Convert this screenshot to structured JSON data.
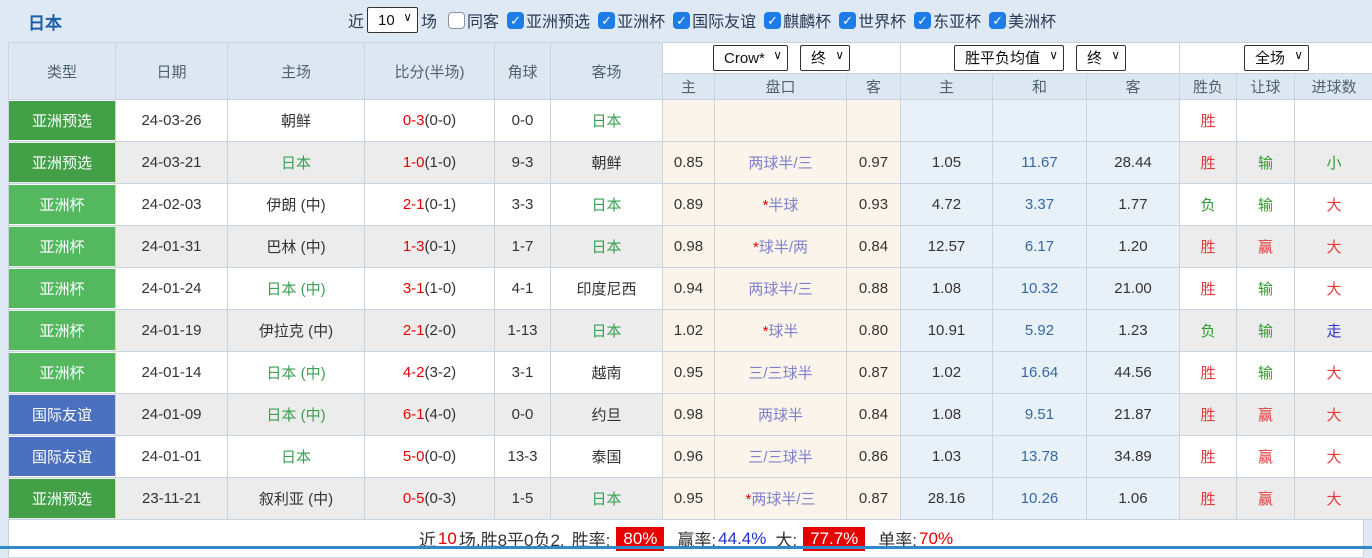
{
  "header": {
    "title": "日本"
  },
  "filters": {
    "recent_label": "近",
    "recent_value": "10",
    "matches_label": "场",
    "same_venue": {
      "label": "同客",
      "checked": false
    },
    "competitions": [
      {
        "label": "亚洲预选",
        "checked": true
      },
      {
        "label": "亚洲杯",
        "checked": true
      },
      {
        "label": "国际友谊",
        "checked": true
      },
      {
        "label": "麒麟杯",
        "checked": true
      },
      {
        "label": "世界杯",
        "checked": true
      },
      {
        "label": "东亚杯",
        "checked": true
      },
      {
        "label": "美洲杯",
        "checked": true
      }
    ]
  },
  "colors": {
    "badge_green_dark": "#43a047",
    "badge_green_light": "#54b85f",
    "badge_blue": "#4b70c0",
    "win_red": "#e23b3b",
    "loss_green": "#319a31",
    "push_blue": "#3333cc",
    "team_green": "#3aa053",
    "score_red": "#e60000",
    "handicap_text": "#8080cf",
    "avg_draw_text": "#3567a6",
    "title_blue": "#1b5fa8",
    "checkbox_blue": "#1e7ce8",
    "rate_badge_bg": "#e60000",
    "bottom_line": "#3089cc"
  },
  "table": {
    "columns": {
      "type": "类型",
      "date": "日期",
      "home": "主场",
      "score": "比分(半场)",
      "corner": "角球",
      "away": "客场",
      "sub_home": "主",
      "sub_handicap": "盘口",
      "sub_away": "客",
      "sub_avg_home": "主",
      "sub_avg_draw": "和",
      "sub_avg_away": "客",
      "result": "胜负",
      "handicap_result": "让球",
      "goals": "进球数"
    },
    "dropdowns": {
      "odds_source": "Crow*",
      "odds_time": "终",
      "avg_source": "胜平负均值",
      "avg_time": "终",
      "scope": "全场"
    },
    "rows": [
      {
        "type": {
          "label": "亚洲预选",
          "style": "green-dark"
        },
        "date": "24-03-26",
        "home": {
          "name": "朝鲜",
          "jp": false
        },
        "score": {
          "main": "0-3",
          "half": "(0-0)"
        },
        "corner": "0-0",
        "away": {
          "name": "日本",
          "jp": true
        },
        "crow": {
          "home": "",
          "star": false,
          "handicap": "",
          "away": ""
        },
        "avg": {
          "home": "",
          "draw": "",
          "away": ""
        },
        "result": {
          "text": "胜",
          "style": "red"
        },
        "let": {
          "text": "",
          "style": ""
        },
        "goals": {
          "text": "",
          "style": ""
        }
      },
      {
        "type": {
          "label": "亚洲预选",
          "style": "green-dark"
        },
        "date": "24-03-21",
        "home": {
          "name": "日本",
          "jp": true
        },
        "score": {
          "main": "1-0",
          "half": "(1-0)"
        },
        "corner": "9-3",
        "away": {
          "name": "朝鲜",
          "jp": false
        },
        "crow": {
          "home": "0.85",
          "star": false,
          "handicap": "两球半/三",
          "away": "0.97"
        },
        "avg": {
          "home": "1.05",
          "draw": "11.67",
          "away": "28.44"
        },
        "result": {
          "text": "胜",
          "style": "red"
        },
        "let": {
          "text": "输",
          "style": "green"
        },
        "goals": {
          "text": "小",
          "style": "green"
        }
      },
      {
        "type": {
          "label": "亚洲杯",
          "style": "green-light"
        },
        "date": "24-02-03",
        "home": {
          "name": "伊朗 (中)",
          "jp": false
        },
        "score": {
          "main": "2-1",
          "half": "(0-1)"
        },
        "corner": "3-3",
        "away": {
          "name": "日本",
          "jp": true
        },
        "crow": {
          "home": "0.89",
          "star": true,
          "handicap": "半球",
          "away": "0.93"
        },
        "avg": {
          "home": "4.72",
          "draw": "3.37",
          "away": "1.77"
        },
        "result": {
          "text": "负",
          "style": "green"
        },
        "let": {
          "text": "输",
          "style": "green"
        },
        "goals": {
          "text": "大",
          "style": "red"
        }
      },
      {
        "type": {
          "label": "亚洲杯",
          "style": "green-light"
        },
        "date": "24-01-31",
        "home": {
          "name": "巴林 (中)",
          "jp": false
        },
        "score": {
          "main": "1-3",
          "half": "(0-1)"
        },
        "corner": "1-7",
        "away": {
          "name": "日本",
          "jp": true
        },
        "crow": {
          "home": "0.98",
          "star": true,
          "handicap": "球半/两",
          "away": "0.84"
        },
        "avg": {
          "home": "12.57",
          "draw": "6.17",
          "away": "1.20"
        },
        "result": {
          "text": "胜",
          "style": "red"
        },
        "let": {
          "text": "赢",
          "style": "red"
        },
        "goals": {
          "text": "大",
          "style": "red"
        }
      },
      {
        "type": {
          "label": "亚洲杯",
          "style": "green-light"
        },
        "date": "24-01-24",
        "home": {
          "name": "日本 (中)",
          "jp": true
        },
        "score": {
          "main": "3-1",
          "half": "(1-0)"
        },
        "corner": "4-1",
        "away": {
          "name": "印度尼西",
          "jp": false
        },
        "crow": {
          "home": "0.94",
          "star": false,
          "handicap": "两球半/三",
          "away": "0.88"
        },
        "avg": {
          "home": "1.08",
          "draw": "10.32",
          "away": "21.00"
        },
        "result": {
          "text": "胜",
          "style": "red"
        },
        "let": {
          "text": "输",
          "style": "green"
        },
        "goals": {
          "text": "大",
          "style": "red"
        }
      },
      {
        "type": {
          "label": "亚洲杯",
          "style": "green-light"
        },
        "date": "24-01-19",
        "home": {
          "name": "伊拉克 (中)",
          "jp": false
        },
        "score": {
          "main": "2-1",
          "half": "(2-0)"
        },
        "corner": "1-13",
        "away": {
          "name": "日本",
          "jp": true
        },
        "crow": {
          "home": "1.02",
          "star": true,
          "handicap": "球半",
          "away": "0.80"
        },
        "avg": {
          "home": "10.91",
          "draw": "5.92",
          "away": "1.23"
        },
        "result": {
          "text": "负",
          "style": "green"
        },
        "let": {
          "text": "输",
          "style": "green"
        },
        "goals": {
          "text": "走",
          "style": "blue"
        }
      },
      {
        "type": {
          "label": "亚洲杯",
          "style": "green-light"
        },
        "date": "24-01-14",
        "home": {
          "name": "日本 (中)",
          "jp": true
        },
        "score": {
          "main": "4-2",
          "half": "(3-2)"
        },
        "corner": "3-1",
        "away": {
          "name": "越南",
          "jp": false
        },
        "crow": {
          "home": "0.95",
          "star": false,
          "handicap": "三/三球半",
          "away": "0.87"
        },
        "avg": {
          "home": "1.02",
          "draw": "16.64",
          "away": "44.56"
        },
        "result": {
          "text": "胜",
          "style": "red"
        },
        "let": {
          "text": "输",
          "style": "green"
        },
        "goals": {
          "text": "大",
          "style": "red"
        }
      },
      {
        "type": {
          "label": "国际友谊",
          "style": "blue"
        },
        "date": "24-01-09",
        "home": {
          "name": "日本 (中)",
          "jp": true
        },
        "score": {
          "main": "6-1",
          "half": "(4-0)"
        },
        "corner": "0-0",
        "away": {
          "name": "约旦",
          "jp": false
        },
        "crow": {
          "home": "0.98",
          "star": false,
          "handicap": "两球半",
          "away": "0.84"
        },
        "avg": {
          "home": "1.08",
          "draw": "9.51",
          "away": "21.87"
        },
        "result": {
          "text": "胜",
          "style": "red"
        },
        "let": {
          "text": "赢",
          "style": "red"
        },
        "goals": {
          "text": "大",
          "style": "red"
        }
      },
      {
        "type": {
          "label": "国际友谊",
          "style": "blue"
        },
        "date": "24-01-01",
        "home": {
          "name": "日本",
          "jp": true
        },
        "score": {
          "main": "5-0",
          "half": "(0-0)"
        },
        "corner": "13-3",
        "away": {
          "name": "泰国",
          "jp": false
        },
        "crow": {
          "home": "0.96",
          "star": false,
          "handicap": "三/三球半",
          "away": "0.86"
        },
        "avg": {
          "home": "1.03",
          "draw": "13.78",
          "away": "34.89"
        },
        "result": {
          "text": "胜",
          "style": "red"
        },
        "let": {
          "text": "赢",
          "style": "red"
        },
        "goals": {
          "text": "大",
          "style": "red"
        }
      },
      {
        "type": {
          "label": "亚洲预选",
          "style": "green-dark"
        },
        "date": "23-11-21",
        "home": {
          "name": "叙利亚 (中)",
          "jp": false
        },
        "score": {
          "main": "0-5",
          "half": "(0-3)"
        },
        "corner": "1-5",
        "away": {
          "name": "日本",
          "jp": true
        },
        "crow": {
          "home": "0.95",
          "star": true,
          "handicap": "两球半/三",
          "away": "0.87"
        },
        "avg": {
          "home": "28.16",
          "draw": "10.26",
          "away": "1.06"
        },
        "result": {
          "text": "胜",
          "style": "red"
        },
        "let": {
          "text": "赢",
          "style": "red"
        },
        "goals": {
          "text": "大",
          "style": "red"
        }
      }
    ]
  },
  "summary": {
    "recent_label": "近",
    "recent_count": "10",
    "stats_text": "场,胜8平0负2,",
    "win_rate_label": "胜率:",
    "win_rate": "80%",
    "profit_rate_label": "赢率:",
    "profit_rate": "44.4%",
    "big_label": "大:",
    "big_rate": "77.7%",
    "single_label": "单率:",
    "single_rate": "70%"
  }
}
